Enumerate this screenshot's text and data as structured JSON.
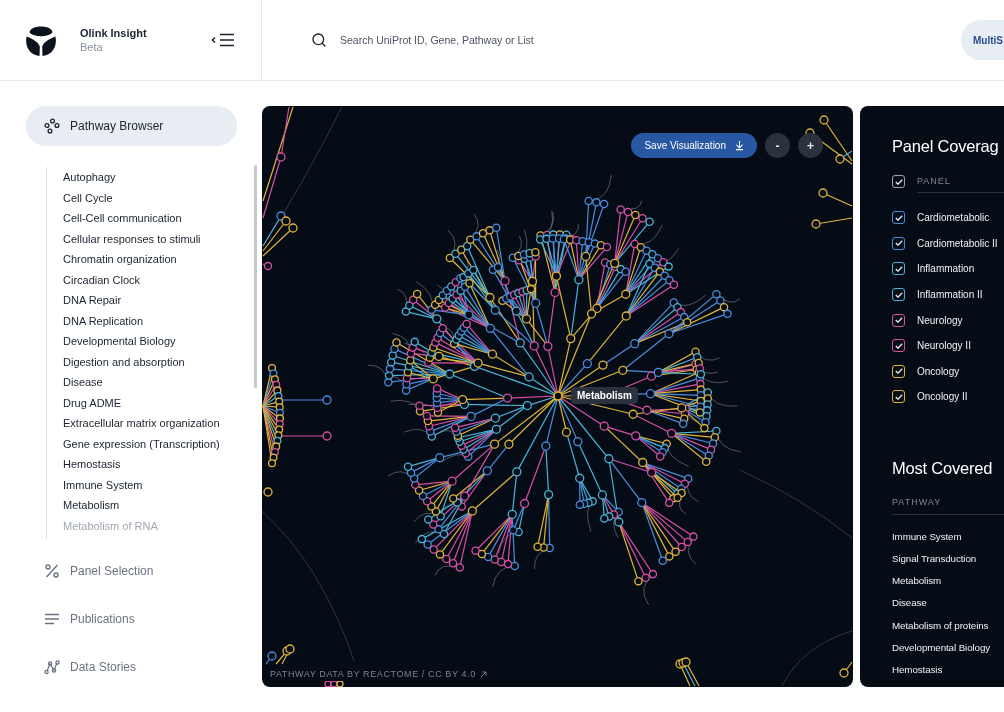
{
  "app": {
    "name": "Olink Insight",
    "tag": "Beta"
  },
  "search": {
    "placeholder": "Search UniProt ID, Gene, Pathway or List"
  },
  "header_button": {
    "label": "MultiS"
  },
  "sidebar": {
    "items": [
      {
        "label": "Pathway Browser",
        "selected": true,
        "children": [
          {
            "label": "Autophagy"
          },
          {
            "label": "Cell Cycle"
          },
          {
            "label": "Cell-Cell communication"
          },
          {
            "label": "Cellular responses to stimuli"
          },
          {
            "label": "Chromatin organization"
          },
          {
            "label": "Circadian Clock"
          },
          {
            "label": "DNA Repair"
          },
          {
            "label": "DNA Replication"
          },
          {
            "label": "Developmental Biology"
          },
          {
            "label": "Digestion and absorption"
          },
          {
            "label": "Disease"
          },
          {
            "label": "Drug ADME"
          },
          {
            "label": "Extracellular matrix organization"
          },
          {
            "label": "Gene expression (Transcription)"
          },
          {
            "label": "Hemostasis"
          },
          {
            "label": "Immune System"
          },
          {
            "label": "Metabolism"
          },
          {
            "label": "Metabolism of RNA"
          }
        ]
      },
      {
        "label": "Panel Selection",
        "selected": false
      },
      {
        "label": "Publications",
        "selected": false
      },
      {
        "label": "Data Stories",
        "selected": false
      }
    ]
  },
  "visualization": {
    "save_button": "Save Visualization",
    "zoom_out": "-",
    "zoom_in": "+",
    "center_label": "Metabolism",
    "credit": "PATHWAY DATA BY REACTOME / CC BY 4.0"
  },
  "panel_coverage": {
    "title": "Panel Coverag",
    "header": {
      "label": "PANEL",
      "checked": true
    },
    "panels": [
      {
        "name": "Cardiometabolic",
        "checked": true,
        "color": "#4a8de0"
      },
      {
        "name": "Cardiometabolic II",
        "checked": true,
        "color": "#4a8de0"
      },
      {
        "name": "Inflammation",
        "checked": true,
        "color": "#4ab3d6"
      },
      {
        "name": "Inflammation II",
        "checked": true,
        "color": "#4ab3d6"
      },
      {
        "name": "Neurology",
        "checked": true,
        "color": "#d94fa6"
      },
      {
        "name": "Neurology II",
        "checked": true,
        "color": "#d94fa6"
      },
      {
        "name": "Oncology",
        "checked": true,
        "color": "#e0b43a"
      },
      {
        "name": "Oncology II",
        "checked": true,
        "color": "#e0b43a"
      }
    ]
  },
  "most_covered": {
    "title": "Most Covered",
    "column": "PATHWAY",
    "pathways": [
      "Immune System",
      "Signal Transduction",
      "Metabolism",
      "Disease",
      "Metabolism of proteins",
      "Developmental Biology",
      "Hemostasis"
    ]
  }
}
